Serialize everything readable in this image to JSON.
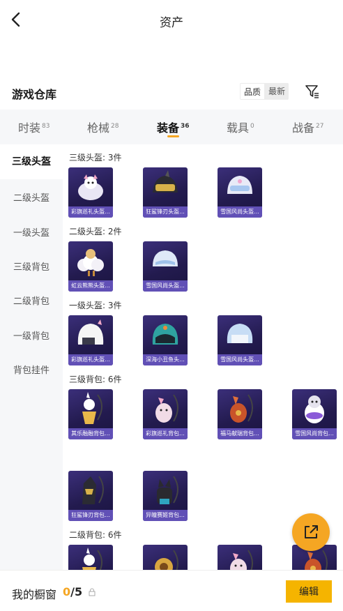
{
  "header": {
    "title": "资产"
  },
  "warehouse": {
    "title": "游戏仓库",
    "sort_quality": "品质",
    "sort_latest": "最新"
  },
  "tabs": [
    {
      "label": "时装",
      "count": "83"
    },
    {
      "label": "枪械",
      "count": "28"
    },
    {
      "label": "装备",
      "count": "36"
    },
    {
      "label": "载具",
      "count": "0"
    },
    {
      "label": "战备",
      "count": "27"
    }
  ],
  "sidebar": [
    {
      "label": "三级头盔"
    },
    {
      "label": "二级头盔"
    },
    {
      "label": "一级头盔"
    },
    {
      "label": "三级背包"
    },
    {
      "label": "二级背包"
    },
    {
      "label": "一级背包"
    },
    {
      "label": "背包挂件"
    }
  ],
  "groups": [
    {
      "title": "三级头盔: 3件",
      "items": [
        {
          "name": "彩旗巡礼头盔...",
          "kind": "helmet-sheep"
        },
        {
          "name": "狂鲨锋刃头盔...",
          "kind": "helmet-shark"
        },
        {
          "name": "雪国风尚头盔...",
          "kind": "helmet-snow"
        }
      ]
    },
    {
      "title": "二级头盔: 2件",
      "items": [
        {
          "name": "虹云熊熊头盔...",
          "kind": "helmet-cloud"
        },
        {
          "name": "雪国风尚头盔...",
          "kind": "helmet-snow2"
        }
      ]
    },
    {
      "title": "一级头盔: 3件",
      "items": [
        {
          "name": "彩旗巡礼头盔...",
          "kind": "helmet-moto"
        },
        {
          "name": "深海小丑鱼头...",
          "kind": "helmet-fish"
        },
        {
          "name": "雪国风尚头盔...",
          "kind": "helmet-ice"
        }
      ]
    },
    {
      "title": "三级背包: 6件",
      "items": [
        {
          "name": "其乐融融背包...",
          "kind": "bag-cake"
        },
        {
          "name": "彩旗巡礼背包...",
          "kind": "bag-pink"
        },
        {
          "name": "福马献瑞背包...",
          "kind": "bag-red"
        },
        {
          "name": "雪国风尚背包...",
          "kind": "bag-penguin"
        },
        {
          "name": "狂鲨锋刃背包...",
          "kind": "bag-shark"
        },
        {
          "name": "异瞳赛姬背包...",
          "kind": "bag-cat"
        }
      ]
    },
    {
      "title": "二级背包: 6件",
      "items": [
        {
          "name": "",
          "kind": "bag-cake"
        },
        {
          "name": "",
          "kind": "bag-gold"
        },
        {
          "name": "",
          "kind": "bag-pink"
        },
        {
          "name": "",
          "kind": "bag-red"
        }
      ]
    }
  ],
  "showcase": {
    "label": "我的橱窗",
    "current": "0",
    "total": "/5"
  },
  "edit_label": "编辑",
  "colors": {
    "accent": "#f5a623",
    "card_bg": "#2b2360",
    "caption_bg": "#6150b6"
  }
}
